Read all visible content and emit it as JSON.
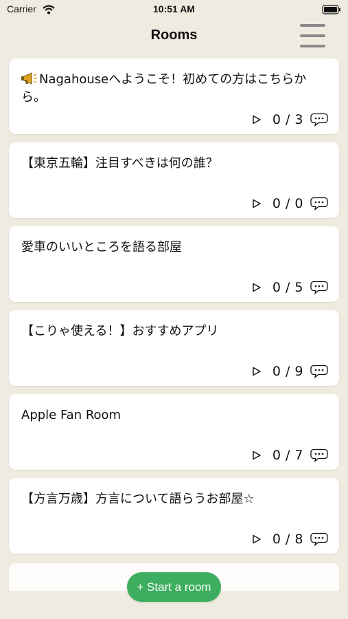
{
  "status_bar": {
    "carrier": "Carrier",
    "time": "10:51 AM"
  },
  "nav": {
    "title": "Rooms",
    "menu_icon": "hamburger-menu-icon"
  },
  "rooms": [
    {
      "title": "Nagahouseへようこそ！初めての方はこちらから。",
      "icon": "megaphone-icon",
      "counts": "0 / 3"
    },
    {
      "title": "【東京五輪】注目すべきは何の誰？",
      "counts": "0 / 0"
    },
    {
      "title": "愛車のいいところを語る部屋",
      "counts": "0 / 5"
    },
    {
      "title": "【こりゃ使える！】おすすめアプリ",
      "counts": "0 / 9"
    },
    {
      "title": "Apple Fan Room",
      "counts": "0 / 7"
    },
    {
      "title": "【方言万歳】方言について語らうお部屋☆",
      "counts": "0 / 8"
    }
  ],
  "start_button": {
    "label": "+ Start a room"
  },
  "colors": {
    "background": "#efebe0",
    "accent": "#3dae5f",
    "card": "#ffffff"
  }
}
